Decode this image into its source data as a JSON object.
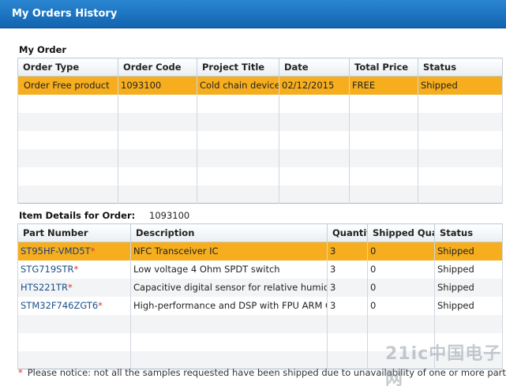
{
  "window": {
    "title": "My Orders History"
  },
  "my_order": {
    "label": "My Order",
    "columns": [
      "Order Type",
      "Order Code",
      "Project Title",
      "Date",
      "Total Price",
      "Status"
    ],
    "rows": [
      [
        "Order Free product",
        "1093100",
        "Cold chain device",
        "02/12/2015",
        "FREE",
        "Shipped"
      ]
    ]
  },
  "item_details": {
    "label": "Item Details for Order:",
    "order_code": "1093100",
    "columns": [
      "Part Number",
      "Description",
      "Quantity",
      "Shipped Quantity",
      "Status"
    ],
    "rows": [
      {
        "part": "ST95HF-VMD5T",
        "desc": "NFC Transceiver IC",
        "qty": "3",
        "shipped": "0",
        "status": "Shipped"
      },
      {
        "part": "STG719STR",
        "desc": "Low voltage 4 Ohm SPDT switch",
        "qty": "3",
        "shipped": "0",
        "status": "Shipped"
      },
      {
        "part": "HTS221TR",
        "desc": "Capacitive digital sensor for relative humidity",
        "qty": "3",
        "shipped": "0",
        "status": "Shipped"
      },
      {
        "part": "STM32F746ZGT6",
        "desc": "High-performance and DSP with FPU ARM Cortex",
        "qty": "3",
        "shipped": "0",
        "status": "Shipped"
      }
    ],
    "required_marker": "*"
  },
  "notice": {
    "marker": "*",
    "text": "Please notice: not all the samples requested have been shipped due to unavailability of one or more parts"
  },
  "watermark": "21ic中国电子网",
  "colors": {
    "titlebar": "#1a74c2",
    "selected_row": "#f6ae1e",
    "part_link": "#1a4f8a",
    "required": "#d9372b"
  }
}
